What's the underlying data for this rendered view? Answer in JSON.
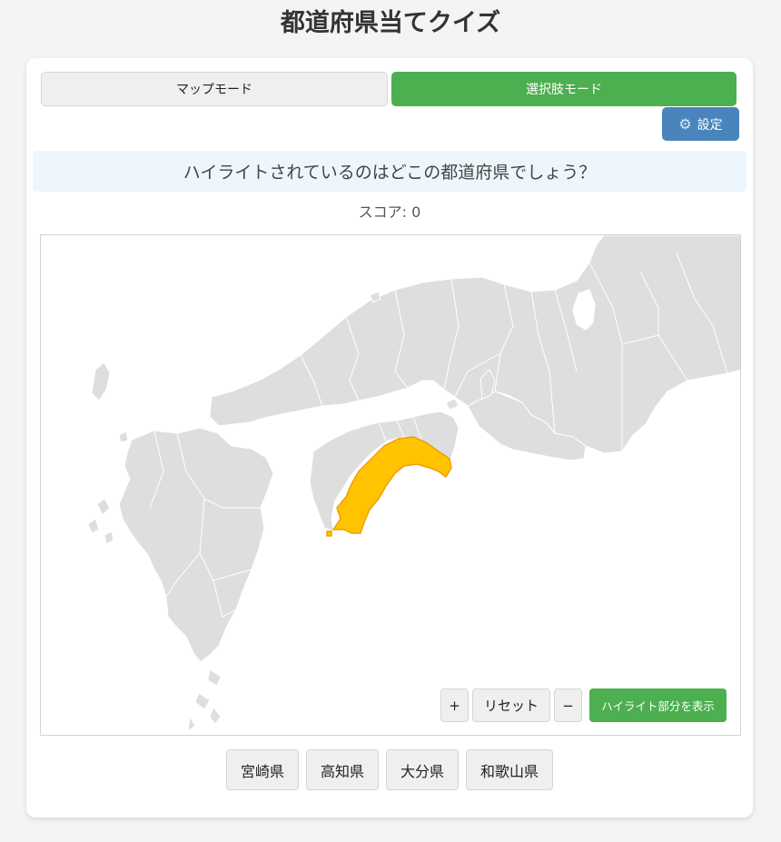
{
  "title": "都道府県当てクイズ",
  "modes": {
    "map_label": "マップモード",
    "choice_label": "選択肢モード",
    "active": "choice"
  },
  "settings": {
    "label": "設定",
    "icon": "gear-icon"
  },
  "question": "ハイライトされているのはどこの都道府県でしょう？",
  "score": "スコア: 0",
  "map": {
    "highlight_color": "#ffc300",
    "land_color": "#dedede",
    "controls": {
      "zoom_in": "+",
      "reset": "リセット",
      "zoom_out": "−",
      "show_highlight": "ハイライト部分を表示"
    }
  },
  "choices": [
    "宮崎県",
    "高知県",
    "大分県",
    "和歌山県"
  ],
  "colors": {
    "accent_green": "#4caf50",
    "settings_blue": "#4a84bd",
    "question_bg": "#eef6fd"
  }
}
